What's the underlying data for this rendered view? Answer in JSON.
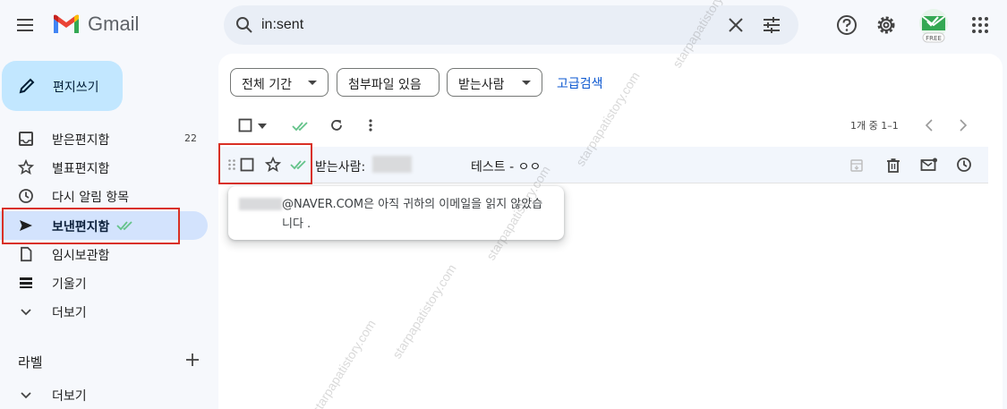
{
  "app": {
    "name": "Gmail"
  },
  "search": {
    "value": "in:sent"
  },
  "sidebar": {
    "compose_label": "편지쓰기",
    "items": [
      {
        "label": "받은편지함",
        "count": "22",
        "icon": "inbox-icon"
      },
      {
        "label": "별표편지함",
        "count": "",
        "icon": "star-icon"
      },
      {
        "label": "다시 알림 항목",
        "count": "",
        "icon": "clock-icon"
      },
      {
        "label": "보낸편지함",
        "count": "",
        "icon": "send-icon",
        "active": true
      },
      {
        "label": "임시보관함",
        "count": "",
        "icon": "draft-icon"
      },
      {
        "label": "기울기",
        "count": "",
        "icon": "stack-icon"
      },
      {
        "label": "더보기",
        "count": "",
        "icon": "chevron-down-icon"
      }
    ],
    "labels_title": "라벨",
    "labels_more": "더보기"
  },
  "avatar": {
    "badge": "FREE"
  },
  "filters": {
    "chips": [
      "전체 기간",
      "첨부파일 있음",
      "받는사람"
    ],
    "advanced": "고급검색"
  },
  "pager": {
    "text": "1개 중 1–1"
  },
  "mail": {
    "recipient_prefix": "받는사람:",
    "subject": "테스트 - ㅇㅇ"
  },
  "tooltip": {
    "email_suffix": "@NAVER.COM은 아직 귀하의 이메일을 읽지 않았습니다 ."
  },
  "watermark": "starpapatistory.com",
  "colors": {
    "accent": "#0b57d0",
    "active_nav": "#d3e3fd",
    "compose": "#c2e7ff",
    "read_check": "#64c38a",
    "highlight_box": "#d93025"
  }
}
